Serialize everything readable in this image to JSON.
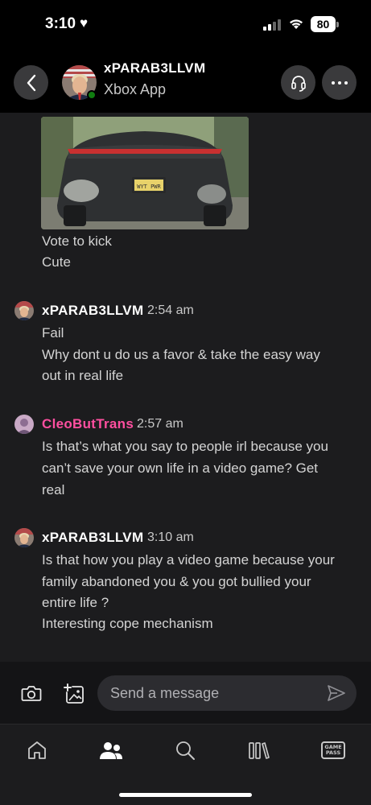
{
  "status_bar": {
    "time": "3:10",
    "heart": "♥",
    "battery": "80"
  },
  "header": {
    "contact_name": "xPARAB3LLVM",
    "subtitle": "Xbox App",
    "status_color": "#107c10"
  },
  "chat": {
    "attachment_caption_lines": [
      "Vote to kick",
      "Cute"
    ],
    "messages": [
      {
        "author": "xPARAB3LLVM",
        "time": "2:54 am",
        "lines": [
          "Fail",
          "Why dont u do us a favor & take the easy way",
          "out in real life"
        ]
      },
      {
        "author": "CleoButTrans",
        "author_color": "#ff4fa0",
        "time": "2:57 am",
        "lines": [
          "Is that’s what you say to people irl because you",
          "can’t save your own life in a video game? Get",
          "real"
        ]
      },
      {
        "author": "xPARAB3LLVM",
        "time": "3:10 am",
        "lines": [
          "Is that how you play a video game because your",
          "family abandoned you & you got bullied your",
          "entire life ?",
          "Interesting cope mechanism"
        ]
      }
    ]
  },
  "composer": {
    "placeholder": "Send a message"
  },
  "tabbar": {
    "items": [
      {
        "name": "home",
        "icon": "home-icon"
      },
      {
        "name": "social",
        "icon": "people-icon",
        "active": true
      },
      {
        "name": "search",
        "icon": "search-icon"
      },
      {
        "name": "library",
        "icon": "library-icon"
      },
      {
        "name": "game-pass",
        "icon": "game-pass-icon",
        "label_line1": "GAME",
        "label_line2": "PASS"
      }
    ]
  }
}
